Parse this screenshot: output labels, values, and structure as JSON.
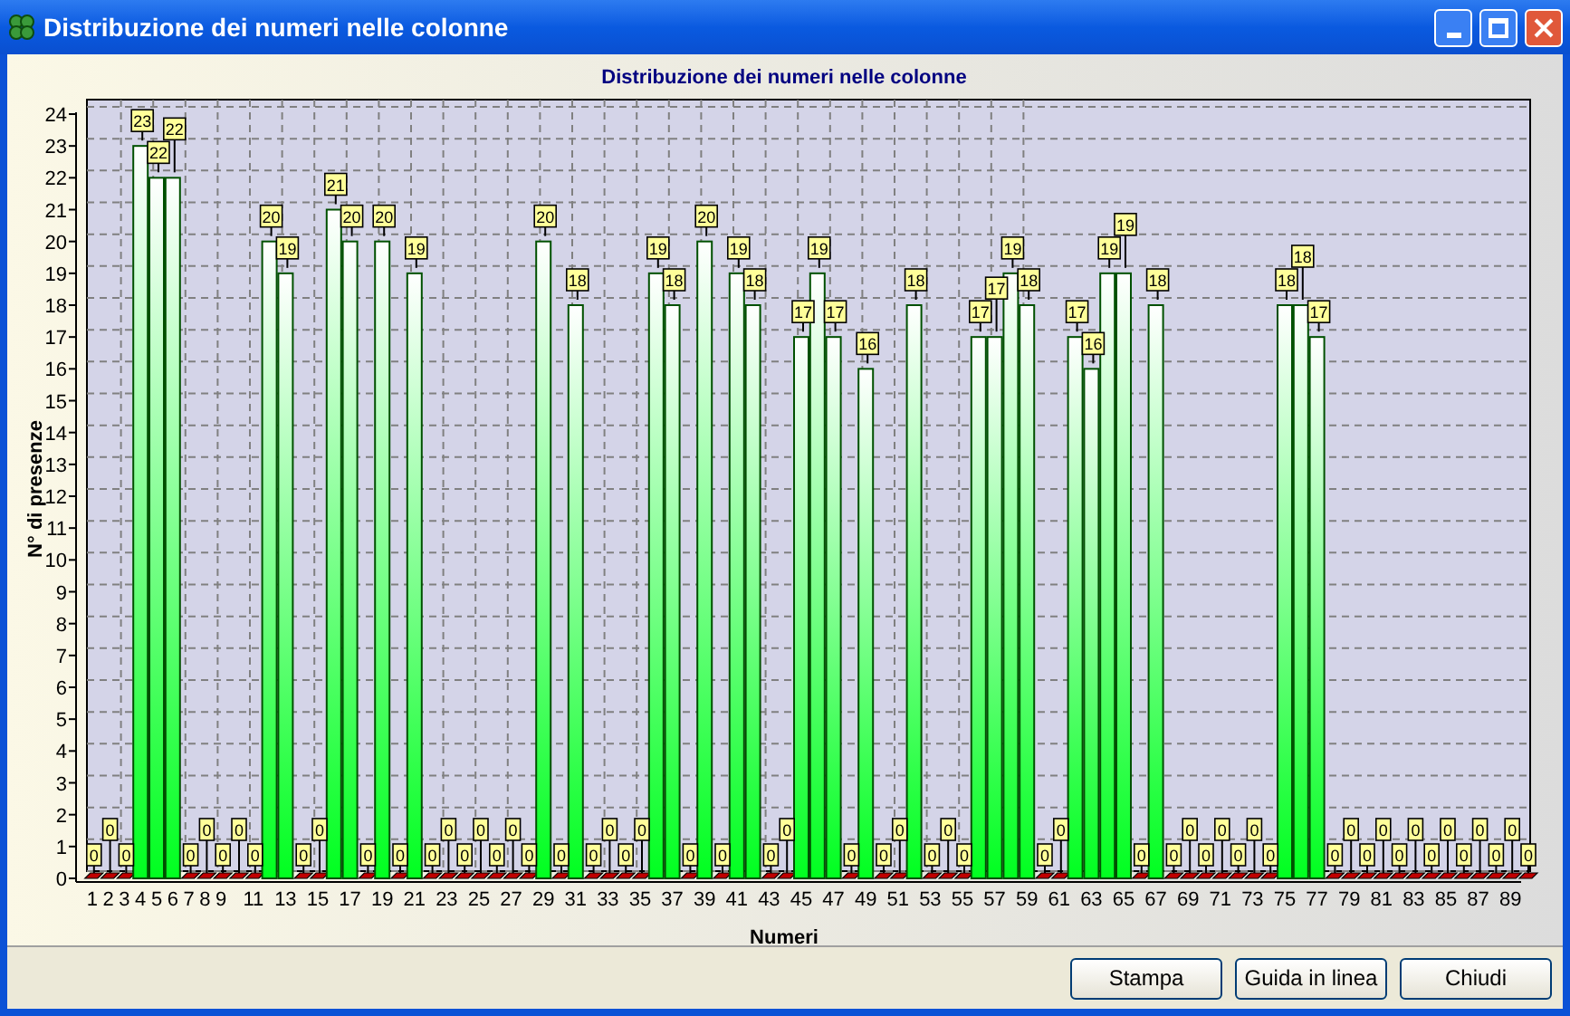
{
  "window": {
    "title": "Distribuzione dei numeri nelle colonne"
  },
  "chart": {
    "chart_data": {
      "type": "bar",
      "title": "Distribuzione dei numeri nelle colonne",
      "xlabel": "Numeri",
      "ylabel": "N° di presenze",
      "x": [
        1,
        2,
        3,
        4,
        5,
        6,
        7,
        8,
        9,
        10,
        11,
        12,
        13,
        14,
        15,
        16,
        17,
        18,
        19,
        20,
        21,
        22,
        23,
        24,
        25,
        26,
        27,
        28,
        29,
        30,
        31,
        32,
        33,
        34,
        35,
        36,
        37,
        38,
        39,
        40,
        41,
        42,
        43,
        44,
        45,
        46,
        47,
        48,
        49,
        50,
        51,
        52,
        53,
        54,
        55,
        56,
        57,
        58,
        59,
        60,
        61,
        62,
        63,
        64,
        65,
        66,
        67,
        68,
        69,
        70,
        71,
        72,
        73,
        74,
        75,
        76,
        77,
        78,
        79,
        80,
        81,
        82,
        83,
        84,
        85,
        86,
        87,
        88,
        89,
        90
      ],
      "values": [
        0,
        0,
        0,
        23,
        22,
        22,
        0,
        0,
        0,
        0,
        0,
        20,
        19,
        0,
        0,
        21,
        20,
        0,
        20,
        0,
        19,
        0,
        0,
        0,
        0,
        0,
        0,
        0,
        20,
        0,
        18,
        0,
        0,
        0,
        0,
        19,
        18,
        0,
        20,
        0,
        19,
        18,
        0,
        0,
        17,
        19,
        17,
        0,
        16,
        0,
        0,
        18,
        0,
        0,
        0,
        17,
        17,
        19,
        18,
        0,
        0,
        17,
        16,
        19,
        19,
        0,
        18,
        0,
        0,
        0,
        0,
        0,
        0,
        0,
        18,
        18,
        17,
        0,
        0,
        0,
        0,
        0,
        0,
        0,
        0,
        0,
        0,
        0,
        0,
        0
      ],
      "xlim": [
        0,
        90
      ],
      "ylim": [
        0,
        24
      ],
      "grid": true,
      "yticks": [
        0,
        1,
        2,
        3,
        4,
        5,
        6,
        7,
        8,
        9,
        10,
        11,
        12,
        13,
        14,
        15,
        16,
        17,
        18,
        19,
        20,
        21,
        22,
        23,
        24
      ],
      "xticks": [
        1,
        2,
        3,
        4,
        5,
        6,
        7,
        8,
        9,
        11,
        13,
        15,
        17,
        19,
        21,
        23,
        25,
        27,
        29,
        31,
        33,
        35,
        37,
        39,
        41,
        43,
        45,
        47,
        49,
        51,
        53,
        55,
        57,
        59,
        61,
        63,
        65,
        67,
        69,
        71,
        73,
        75,
        77,
        79,
        81,
        83,
        85,
        87,
        89
      ],
      "data_labels": true
    }
  },
  "buttons": [
    {
      "label": "Stampa"
    },
    {
      "label": "Guida in linea"
    },
    {
      "label": "Chiudi"
    }
  ]
}
